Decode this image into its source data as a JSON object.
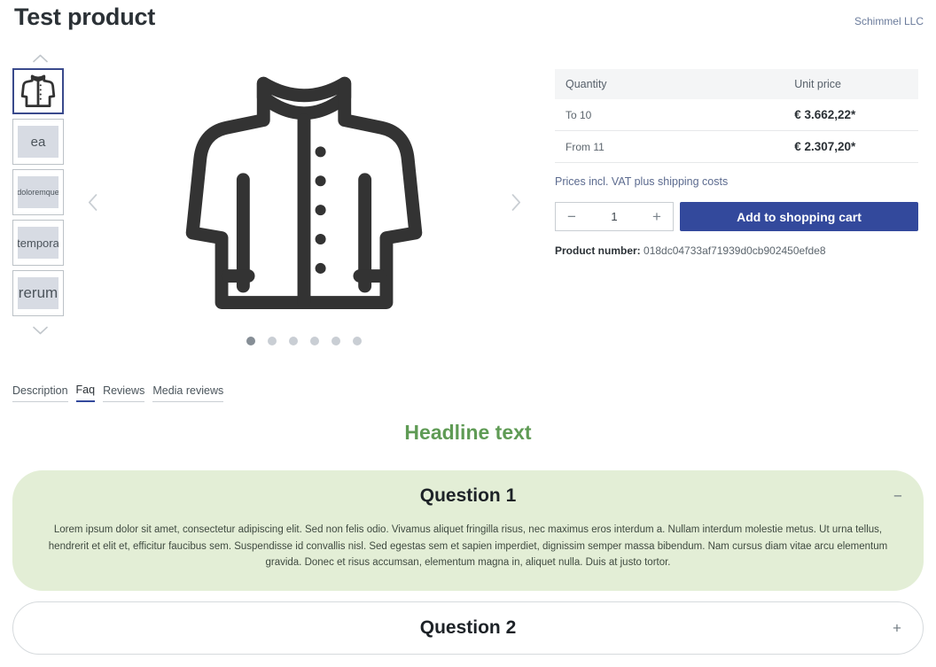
{
  "header": {
    "title": "Test product",
    "manufacturer": "Schimmel LLC"
  },
  "gallery": {
    "up_arrow_icon": "chevron-up-icon",
    "down_arrow_icon": "chevron-down-icon",
    "prev_arrow_icon": "chevron-left-icon",
    "next_arrow_icon": "chevron-right-icon",
    "thumbnails": [
      {
        "label": "",
        "type": "jacket-image",
        "active": true
      },
      {
        "label": "ea",
        "type": "placeholder",
        "active": false
      },
      {
        "label": "doloremque",
        "type": "placeholder",
        "active": false
      },
      {
        "label": "tempora",
        "type": "placeholder",
        "active": false
      },
      {
        "label": "rerum",
        "type": "placeholder",
        "active": false
      }
    ],
    "dots_total": 6,
    "dots_active_index": 0,
    "main_image_name": "jacket-illustration"
  },
  "buybox": {
    "table": {
      "headers": [
        "Quantity",
        "Unit price"
      ],
      "rows": [
        {
          "quantity": "To 10",
          "price": "€ 3.662,22*"
        },
        {
          "quantity": "From 11",
          "price": "€ 2.307,20*"
        }
      ]
    },
    "vat_note": "Prices incl. VAT plus shipping costs",
    "quantity": {
      "decrease_label": "−",
      "value": "1",
      "increase_label": "+"
    },
    "cart_button": "Add to shopping cart",
    "product_number_label": "Product number:",
    "product_number_value": "018dc04733af71939d0cb902450efde8"
  },
  "tabs": [
    {
      "label": "Description",
      "active": false
    },
    {
      "label": "Faq",
      "active": true
    },
    {
      "label": "Reviews",
      "active": false
    },
    {
      "label": "Media reviews",
      "active": false
    }
  ],
  "headline": "Headline text",
  "accordion": [
    {
      "title": "Question 1",
      "toggle": "−",
      "open": true,
      "body": "Lorem ipsum dolor sit amet, consectetur adipiscing elit. Sed non felis odio. Vivamus aliquet fringilla risus, nec maximus eros interdum a. Nullam interdum molestie metus. Ut urna tellus, hendrerit et elit et, efficitur faucibus sem. Suspendisse id convallis nisl. Sed egestas sem et sapien imperdiet, dignissim semper massa bibendum. Nam cursus diam vitae arcu elementum gravida. Donec et risus accumsan, elementum magna in, aliquet nulla. Duis at justo tortor."
    },
    {
      "title": "Question 2",
      "toggle": "+",
      "open": false,
      "body": ""
    }
  ],
  "colors": {
    "accent_blue": "#33499c",
    "headline_green": "#5f9b55",
    "accordion_green": "#e3eed6",
    "title_dark": "#2b3136",
    "muted": "#5c656d"
  }
}
